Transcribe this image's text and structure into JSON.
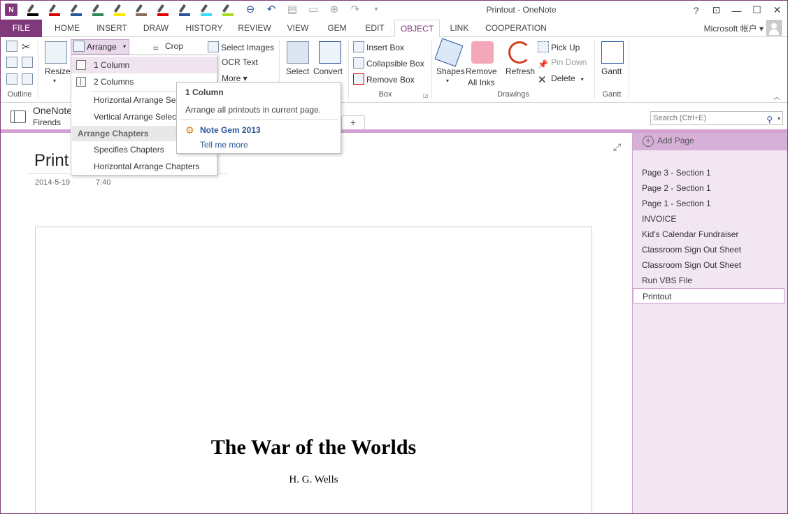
{
  "app": {
    "title": "Printout - OneNote",
    "app_icon_label": "N",
    "accent_color": "#80397b"
  },
  "quick_access": {
    "pen_colors": [
      "#000000",
      "#e00000",
      "#2b579a",
      "#2e8b57",
      "#ffe600",
      "#8b6f5a",
      "#e00000",
      "#2b579a",
      "#33e0ff",
      "#a8e020"
    ]
  },
  "window_controls": {
    "help": "?",
    "restore_ribbon": "⊡",
    "minimize": "—",
    "maximize": "☐",
    "close": "✕"
  },
  "tabs": {
    "file": "FILE",
    "home": "HOME",
    "insert": "INSERT",
    "draw": "DRAW",
    "history": "HISTORY",
    "review": "REVIEW",
    "view": "VIEW",
    "gem": "GEM",
    "edit": "EDIT",
    "object": "OBJECT",
    "link": "LINK",
    "cooperation": "COOPERATION",
    "account": "Microsoft 帐户 ▾"
  },
  "ribbon": {
    "outline_label": "Outline",
    "resize_label": "Resize",
    "arrange_label": "Arrange",
    "crop_label": "Crop",
    "select_images_label": "Select Images",
    "ocr_text_label": "OCR Text",
    "more_label": "More ▾",
    "select_label": "Select",
    "convert_label": "Convert",
    "insert_box_label": "Insert Box",
    "collapsible_box_label": "Collapsible Box",
    "remove_box_label": "Remove Box",
    "box_group_label": "Box",
    "shapes_label": "Shapes",
    "remove_all_inks_label_1": "Remove",
    "remove_all_inks_label_2": "All Inks",
    "refresh_label": "Refresh",
    "pick_up_label": "Pick Up",
    "pin_down_label": "Pin Down",
    "delete_label": "Delete",
    "drawings_group_label": "Drawings",
    "gantt_label": "Gantt",
    "gantt_group_label": "Gantt"
  },
  "arrange_menu": {
    "one_column": "1 Column",
    "two_columns": "2 Columns",
    "horizontal_arrange_select": "Horizontal Arrange Sele",
    "vertical_arrange_select": "Vertical Arrange Select",
    "arrange_chapters_header": "Arrange Chapters",
    "specifies_chapters": "Specifies Chapters",
    "horizontal_arrange_chapters": "Horizontal Arrange Chapters"
  },
  "tooltip": {
    "title": "1 Column",
    "description": "Arrange all printouts in current page.",
    "addin_name": "Note Gem 2013",
    "tell_me_more": "Tell me more"
  },
  "notebook": {
    "name": "OneNote",
    "section": "Firends",
    "add_tab": "+"
  },
  "search": {
    "placeholder": "Search (Ctrl+E)"
  },
  "page": {
    "title": "Print",
    "date": "2014-5-19",
    "time": "7:40",
    "book_title": "The War of the Worlds",
    "book_author": "H. G. Wells"
  },
  "page_list": {
    "add_page_label": "Add Page",
    "items": [
      "Page 3 - Section 1",
      "Page 2 - Section 1",
      "Page 1 - Section 1",
      "INVOICE",
      "Kid's Calendar Fundraiser",
      "Classroom Sign Out Sheet",
      "Classroom Sign Out Sheet",
      "Run VBS File",
      "Printout"
    ],
    "selected": "Printout"
  }
}
